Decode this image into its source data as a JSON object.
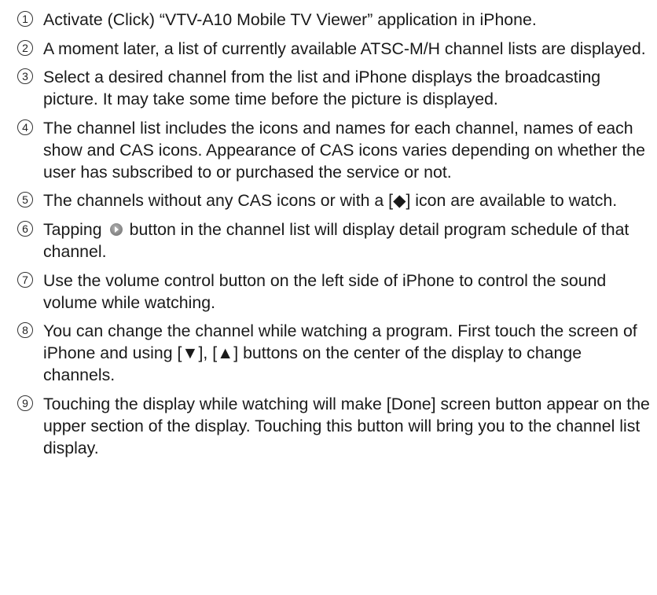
{
  "steps": [
    {
      "num": "1",
      "text": "Activate (Click) “VTV-A10 Mobile TV Viewer” application in iPhone."
    },
    {
      "num": "2",
      "text": "A moment later, a list of currently available ATSC-M/H channel lists are displayed."
    },
    {
      "num": "3",
      "text": "Select a desired channel from the list and iPhone displays the broadcasting picture. It may take some time before the picture is displayed."
    },
    {
      "num": "4",
      "text": "The channel list includes the icons and names for each channel, names of each show and CAS icons. Appearance of CAS icons varies depending on whether the user has subscribed to or purchased the service or not."
    },
    {
      "num": "5",
      "text": "The channels without any CAS icons or with a [◆] icon are available to watch."
    },
    {
      "num": "6",
      "text_before": "Tapping",
      "icon": "detail-arrow-button-icon",
      "text_after": "button in the channel list will display detail program schedule of that channel."
    },
    {
      "num": "7",
      "text": "Use the volume control button on the left side of iPhone to control the sound volume while watching."
    },
    {
      "num": "8",
      "text": "You can change the channel while watching a program. First touch the screen of iPhone and using [▼], [▲] buttons on the center of the display to change channels."
    },
    {
      "num": "9",
      "text": "Touching the display while watching will make [Done] screen button appear on the upper section of the display. Touching this button will bring you to the channel list display."
    }
  ]
}
